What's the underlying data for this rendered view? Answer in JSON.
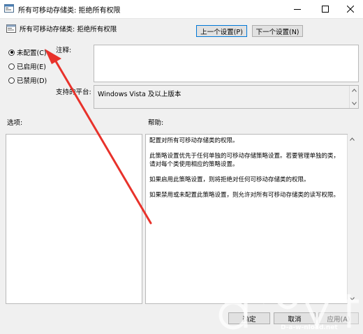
{
  "window": {
    "title": "所有可移动存储类: 拒绝所有权限",
    "min_icon": "minimize-icon",
    "max_icon": "maximize-icon",
    "close_icon": "close-icon"
  },
  "header": {
    "policy_title": "所有可移动存储类: 拒绝所有权限",
    "prev_button": "上一个设置(P)",
    "next_button": "下一个设置(N)"
  },
  "state": {
    "not_configured": "未配置(C)",
    "enabled": "已启用(E)",
    "disabled": "已禁用(D)",
    "selected": "not_configured"
  },
  "comment": {
    "label": "注释:",
    "value": ""
  },
  "platform": {
    "label": "支持的平台:",
    "value": "Windows Vista 及以上版本"
  },
  "options": {
    "label": "选项:"
  },
  "help": {
    "label": "帮助:",
    "paragraphs": [
      "配置对所有可移动存储类的权限。",
      "此策略设置优先于任何单独的可移动存储策略设置。若要管理单独的类，请对每个类使用相应的策略设置。",
      "如果启用此策略设置，则将拒绝对任何可移动存储类的权限。",
      "如果禁用或未配置此策略设置，则允许对所有可移动存储类的读写权限。"
    ]
  },
  "footer": {
    "ok": "确定",
    "cancel": "取消",
    "apply": "应用(A)"
  },
  "watermark": {
    "text": "D-a-w-nload.net"
  },
  "colors": {
    "annotation_arrow": "#e8322b",
    "accent": "#0078d7"
  }
}
